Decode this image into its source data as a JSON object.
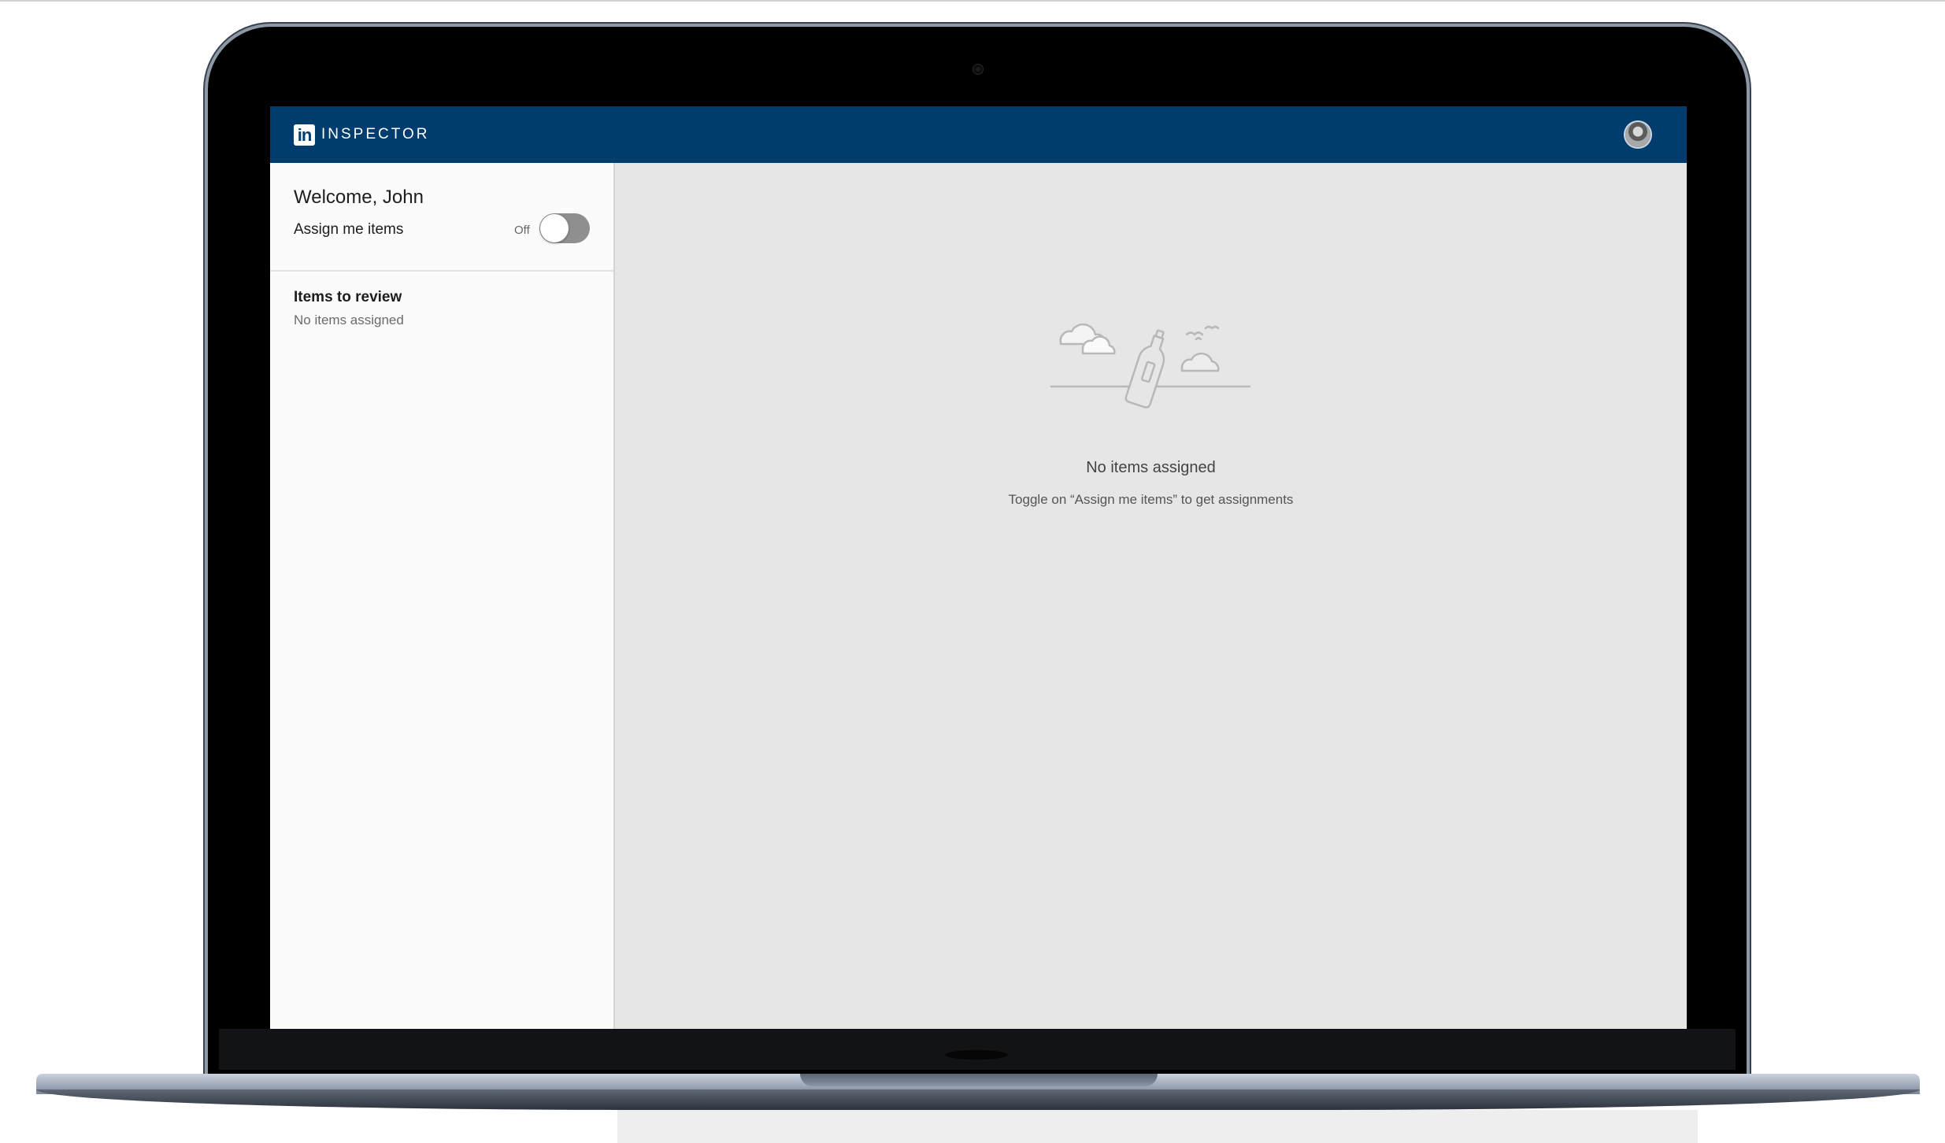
{
  "navbar": {
    "logo_text": "in",
    "app_name": "INSPECTOR",
    "avatar_icon": "user-avatar-icon",
    "background_color": "#003c6d"
  },
  "sidebar": {
    "welcome": "Welcome, John",
    "assign_label": "Assign me items",
    "toggle_state": "Off",
    "toggle_on": false,
    "review_title": "Items to review",
    "review_status": "No items assigned"
  },
  "main": {
    "illustration_icon": "bottle-in-sea-illustration",
    "empty_title": "No items assigned",
    "empty_message": "Toggle on “Assign me items” to get assignments"
  }
}
